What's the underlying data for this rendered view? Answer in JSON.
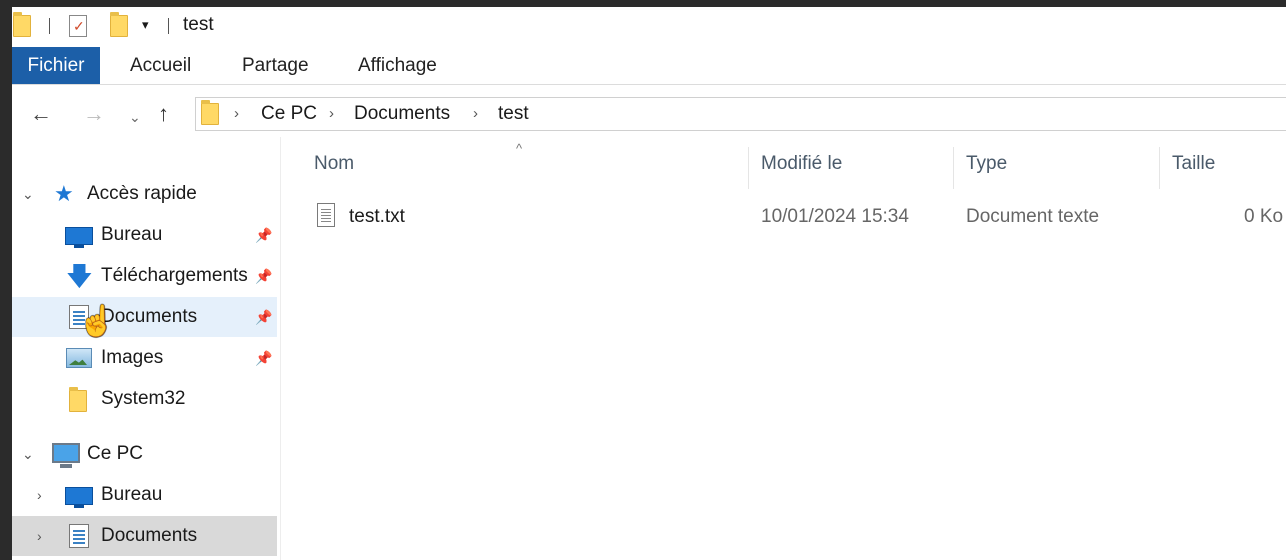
{
  "window": {
    "title": "test"
  },
  "quick_access": {
    "dropdown_glyph": "▾"
  },
  "ribbon": {
    "tabs": [
      "Fichier",
      "Accueil",
      "Partage",
      "Affichage"
    ]
  },
  "navigation": {
    "back": "←",
    "forward": "→",
    "recent": "⌄",
    "up": "↑",
    "breadcrumb": [
      "Ce PC",
      "Documents",
      "test"
    ],
    "separator": "›"
  },
  "sidebar": {
    "quick_access_label": "Accès rapide",
    "pinned": [
      {
        "label": "Bureau",
        "icon": "desktop-icon"
      },
      {
        "label": "Téléchargements",
        "icon": "download-icon"
      },
      {
        "label": "Documents",
        "icon": "documents-icon"
      },
      {
        "label": "Images",
        "icon": "images-icon"
      }
    ],
    "recent_folder": {
      "label": "System32",
      "icon": "folder-icon"
    },
    "this_pc_label": "Ce PC",
    "this_pc_children": [
      {
        "label": "Bureau",
        "icon": "desktop-icon"
      },
      {
        "label": "Documents",
        "icon": "documents-icon"
      }
    ],
    "pin_glyph": "📌",
    "expand_glyph": "⌄",
    "collapse_glyph": "›"
  },
  "file_list": {
    "columns": [
      "Nom",
      "Modifié le",
      "Type",
      "Taille"
    ],
    "sort_glyph": "^",
    "rows": [
      {
        "name": "test.txt",
        "modified": "10/01/2024 15:34",
        "type": "Document texte",
        "size": "0 Ko",
        "icon": "text-file-icon"
      }
    ]
  },
  "colors": {
    "accent": "#1c5fa8",
    "hover": "#e5f0fb",
    "selected": "#d9d9d9"
  }
}
